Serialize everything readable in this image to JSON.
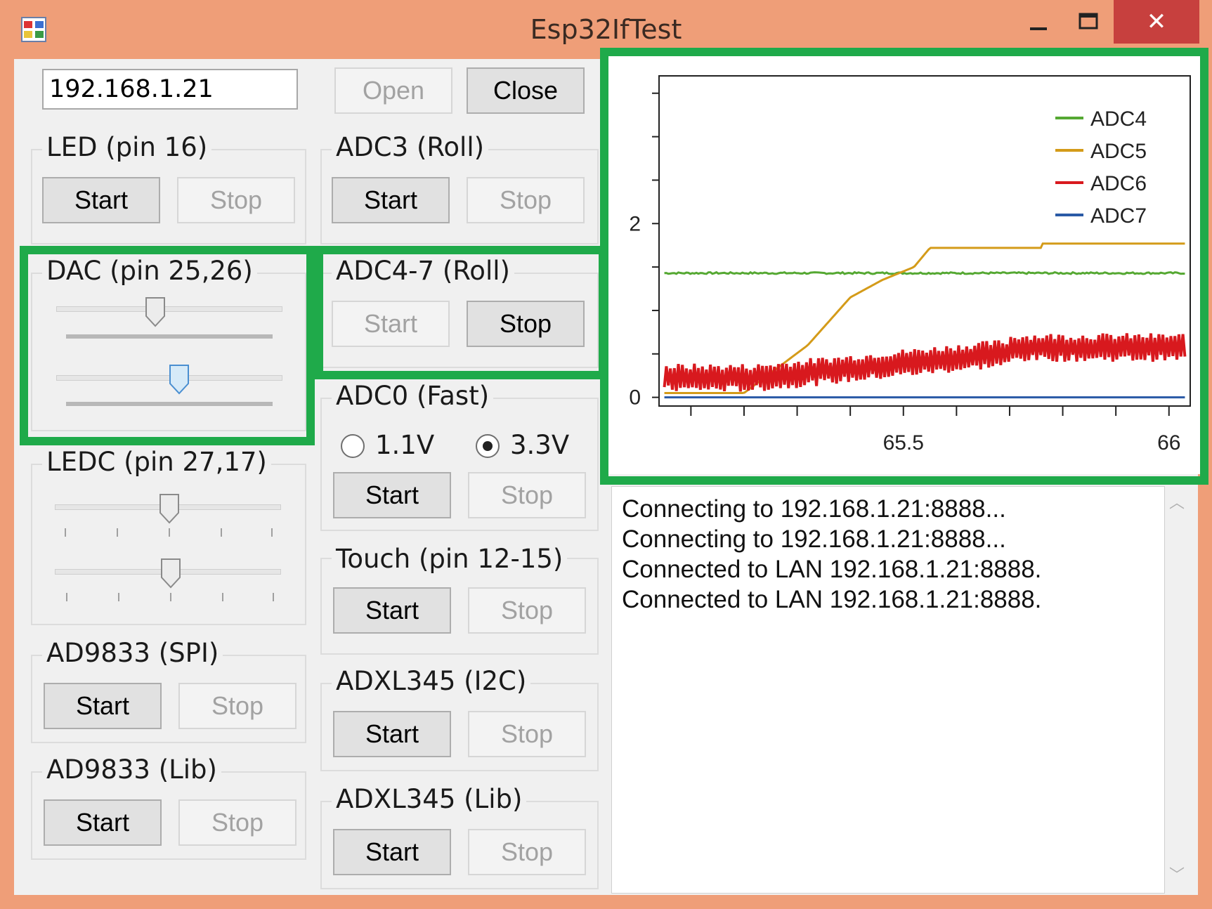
{
  "window": {
    "title": "Esp32IfTest",
    "minimize_glyph": "—",
    "maximize_glyph": "☐",
    "close_glyph": "✕",
    "icon": "app-window-icon"
  },
  "connection": {
    "address": "192.168.1.21",
    "open_label": "Open",
    "close_label": "Close"
  },
  "groups": {
    "led": {
      "label": "LED (pin 16)",
      "start": "Start",
      "stop": "Stop"
    },
    "adc3": {
      "label": "ADC3 (Roll)",
      "start": "Start",
      "stop": "Stop"
    },
    "dac": {
      "label": "DAC (pin 25,26)",
      "slider1_value": 0.45,
      "slider2_value": 0.55
    },
    "adc47": {
      "label": "ADC4-7 (Roll)",
      "start": "Start",
      "stop": "Stop"
    },
    "adc0": {
      "label": "ADC0 (Fast)",
      "radio1": "1.1V",
      "radio2": "3.3V",
      "selected": "3.3V",
      "start": "Start",
      "stop": "Stop"
    },
    "ledc": {
      "label": "LEDC (pin 27,17)",
      "slider1_value": 0.5,
      "slider2_value": 0.5
    },
    "touch": {
      "label": "Touch (pin 12-15)",
      "start": "Start",
      "stop": "Stop"
    },
    "ad9833spi": {
      "label": "AD9833 (SPI)",
      "start": "Start",
      "stop": "Stop"
    },
    "adxl_i2c": {
      "label": "ADXL345 (I2C)",
      "start": "Start",
      "stop": "Stop"
    },
    "ad9833lib": {
      "label": "AD9833 (Lib)",
      "start": "Start",
      "stop": "Stop"
    },
    "adxl_lib": {
      "label": "ADXL345 (Lib)",
      "start": "Start",
      "stop": "Stop"
    }
  },
  "chart_data": {
    "type": "line",
    "xlim": [
      65.04,
      66.04
    ],
    "ylim": [
      -0.1,
      3.7
    ],
    "xticks": [
      "65.5",
      "66"
    ],
    "yticks": [
      "0",
      "2"
    ],
    "legend_position": "top-right",
    "series": [
      {
        "name": "ADC4",
        "color": "#55a832",
        "shape": "flat",
        "level": 1.43
      },
      {
        "name": "ADC5",
        "color": "#d49b19",
        "shape": "ramp"
      },
      {
        "name": "ADC6",
        "color": "#d8191e",
        "shape": "noise"
      },
      {
        "name": "ADC7",
        "color": "#2a5aa6",
        "shape": "flat",
        "level": 0.0
      }
    ]
  },
  "log": {
    "lines": [
      "Connecting to 192.168.1.21:8888...",
      "Connecting to 192.168.1.21:8888...",
      "Connected to LAN 192.168.1.21:8888.",
      "Connected to LAN 192.168.1.21:8888."
    ]
  }
}
